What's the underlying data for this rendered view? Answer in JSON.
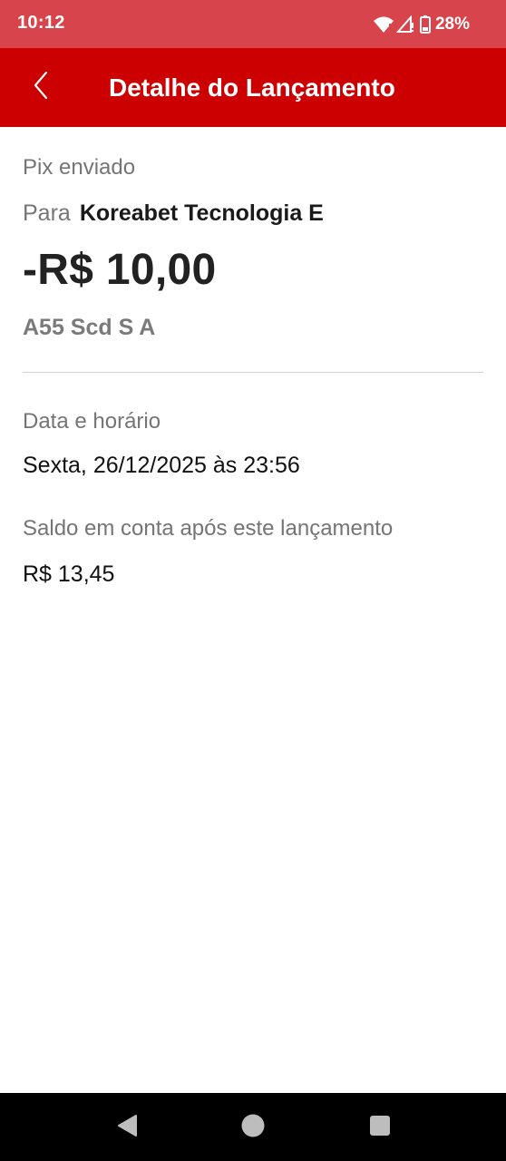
{
  "status_bar": {
    "time": "10:12",
    "battery_percent": "28%",
    "icons": [
      "wifi-icon",
      "signal-no-service-icon",
      "battery-icon"
    ]
  },
  "app_bar": {
    "back_icon": "chevron-left-icon",
    "title": "Detalhe do Lançamento"
  },
  "transaction": {
    "type": "Pix enviado",
    "recipient_prefix": "Para",
    "recipient_name_line1": "Koreabet Tecnologia E",
    "amount": "-R$ 10,00",
    "recipient_name_line2": "A55 Scd S A"
  },
  "details": {
    "date_label": "Data e horário",
    "date_value": "Sexta, 26/12/2025 às 23:56",
    "balance_label": "Saldo em conta após este lançamento",
    "balance_value": "R$ 13,45"
  },
  "nav_bar": {
    "buttons": [
      "back-triangle-icon",
      "home-circle-icon",
      "recents-square-icon"
    ]
  },
  "colors": {
    "status_bar": "#d8444b",
    "app_bar": "#cc0000",
    "label_gray": "#757575",
    "text_dark": "#222222"
  }
}
